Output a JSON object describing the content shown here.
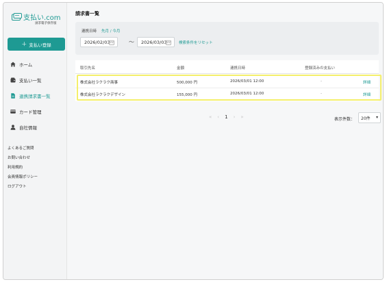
{
  "brand": {
    "name": "支払い",
    "suffix": ".com",
    "subtitle": "請求電子保存版"
  },
  "sidebar": {
    "register_button": "支払い登録",
    "items": [
      {
        "label": "ホーム",
        "icon": "home-icon"
      },
      {
        "label": "支払い一覧",
        "icon": "wallet-icon"
      },
      {
        "label": "連携請求書一覧",
        "icon": "document-icon",
        "active": true
      },
      {
        "label": "カード管理",
        "icon": "card-icon"
      },
      {
        "label": "自社情報",
        "icon": "user-icon"
      }
    ],
    "links": [
      "よくあるご質問",
      "お問い合わせ",
      "利用規約",
      "会員情報ポリシー",
      "ログアウト"
    ]
  },
  "main": {
    "title": "請求書一覧",
    "filter": {
      "label": "連携日時",
      "quick": "先月 / 今月",
      "from": "2026/02/03",
      "to": "2026/03/03",
      "tilde": "〜",
      "reset": "検索条件をリセット"
    },
    "table": {
      "columns": [
        "取引先名",
        "金額",
        "連携日時",
        "登録済みの支払い",
        ""
      ],
      "rows": [
        {
          "partner": "株式会社ラクラク商事",
          "amount": "500,000 円",
          "datetime": "2026/03/01 12:00",
          "registered": "-",
          "action": "詳細"
        },
        {
          "partner": "株式会社ラクラクデザイン",
          "amount": "155,000 円",
          "datetime": "2026/03/01 12:00",
          "registered": "-",
          "action": "詳細"
        }
      ]
    },
    "pagination": {
      "first": "«",
      "prev": "‹",
      "current": "1",
      "next": "›",
      "last": "»"
    },
    "per_page": {
      "label": "表示件数：",
      "value": "20件",
      "chevron": "▾"
    }
  },
  "colors": {
    "accent": "#1e9a93",
    "highlight": "#f4ef6a"
  }
}
